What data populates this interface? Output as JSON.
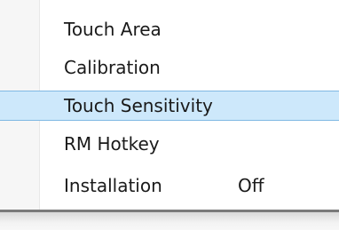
{
  "menu": {
    "items": [
      {
        "label": "Touch Area",
        "value": ""
      },
      {
        "label": "Calibration",
        "value": ""
      },
      {
        "label": "Touch Sensitivity",
        "value": ""
      },
      {
        "label": "RM Hotkey",
        "value": ""
      },
      {
        "label": "Installation",
        "value": "Off"
      }
    ],
    "highlighted_index": 2,
    "colors": {
      "highlight_fill": "#cde8fb",
      "highlight_border": "#7fb8e3",
      "text": "#1a1a1a"
    }
  }
}
